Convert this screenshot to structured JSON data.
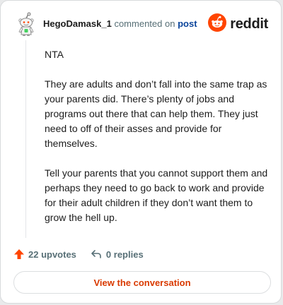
{
  "header": {
    "author": "HegoDamask_1",
    "verb": "commented on",
    "post_link": "post",
    "brand": "reddit",
    "avatar_icon": "snoo-avatar-icon",
    "brand_icon": "reddit-logo-icon"
  },
  "comment": {
    "paragraphs": [
      "NTA",
      "They are adults and don’t fall into the same trap as your parents did. There’s plenty of jobs and programs out there that can help them. They just need to off of their asses and provide for themselves.",
      "Tell your parents that you cannot support them and perhaps they need to go back to work and provide for their adult children if they don’t want them to grow the hell up."
    ]
  },
  "stats": {
    "upvotes": "22 upvotes",
    "replies": "0 replies",
    "upvote_icon": "upvote-arrow-icon",
    "reply_icon": "reply-arrow-icon"
  },
  "cta": {
    "label": "View the conversation"
  },
  "colors": {
    "accent": "#ff4500",
    "link": "#0a449b",
    "cta_text": "#d93a00",
    "muted": "#576f76"
  }
}
